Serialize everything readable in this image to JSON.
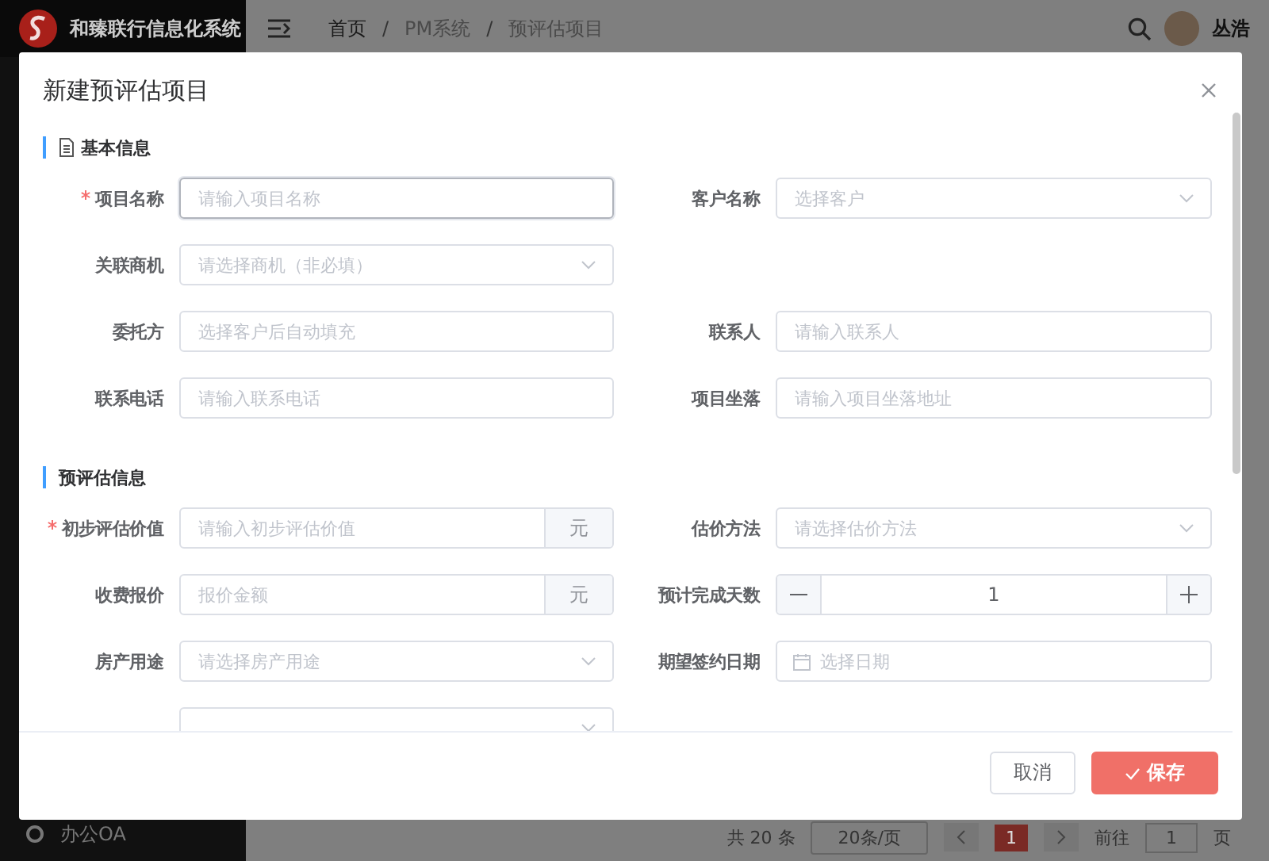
{
  "app": {
    "title": "和臻联行信息化系统"
  },
  "breadcrumb": [
    {
      "label": "首页",
      "link": true
    },
    {
      "separator": "/",
      "label": "PM系统",
      "link": false
    },
    {
      "separator": "/",
      "label": "预评估项目",
      "link": false
    }
  ],
  "user": {
    "name": "丛浩"
  },
  "sidebar": {
    "items": [
      {
        "label": "办公OA"
      }
    ]
  },
  "pagination": {
    "total": "共 20 条",
    "page_size": "20条/页",
    "pages": [
      {
        "label": "1",
        "selected": true
      }
    ],
    "goto_label": "前往",
    "goto_value": "1",
    "goto_suffix": "页"
  },
  "dialog": {
    "title": "新建预评估项目",
    "sections": [
      {
        "title": "基本信息",
        "has_icon": true,
        "rows": [
          [
            {
              "label": "项目名称",
              "required": true,
              "kind": "input",
              "placeholder": "请输入项目名称",
              "focused": true
            },
            {
              "label": "客户名称",
              "required": false,
              "kind": "select",
              "placeholder": "选择客户",
              "focused": false
            }
          ],
          [
            {
              "label": "关联商机",
              "required": false,
              "kind": "select",
              "placeholder": "请选择商机（非必填）",
              "focused": false
            }
          ],
          [
            {
              "label": "委托方",
              "required": false,
              "kind": "input",
              "placeholder": "选择客户后自动填充",
              "focused": false
            },
            {
              "label": "联系人",
              "required": false,
              "kind": "input",
              "placeholder": "请输入联系人",
              "focused": false
            }
          ],
          [
            {
              "label": "联系电话",
              "required": false,
              "kind": "input",
              "placeholder": "请输入联系电话",
              "focused": false
            },
            {
              "label": "项目坐落",
              "required": false,
              "kind": "input",
              "placeholder": "请输入项目坐落地址",
              "focused": false
            }
          ]
        ]
      },
      {
        "title": "预评估信息",
        "has_icon": false,
        "rows": [
          [
            {
              "label": "初步评估价值",
              "required": true,
              "kind": "suffix",
              "placeholder": "请输入初步评估价值",
              "suffix": "元",
              "focused": false
            },
            {
              "label": "估价方法",
              "required": false,
              "kind": "select",
              "placeholder": "请选择估价方法",
              "focused": false
            }
          ],
          [
            {
              "label": "收费报价",
              "required": false,
              "kind": "suffix",
              "placeholder": "报价金额",
              "suffix": "元",
              "focused": false
            },
            {
              "label": "预计完成天数",
              "required": false,
              "kind": "stepper",
              "value": "1",
              "focused": false
            }
          ],
          [
            {
              "label": "房产用途",
              "required": false,
              "kind": "select",
              "placeholder": "请选择房产用途",
              "focused": false
            },
            {
              "label": "期望签约日期",
              "required": false,
              "kind": "date",
              "placeholder": "选择日期",
              "focused": false
            }
          ],
          [
            {
              "kind": "select",
              "focused": false
            }
          ]
        ]
      }
    ],
    "buttons": [
      {
        "label": "取消",
        "kind": "plain"
      },
      {
        "label": "保存",
        "kind": "primary"
      }
    ]
  }
}
